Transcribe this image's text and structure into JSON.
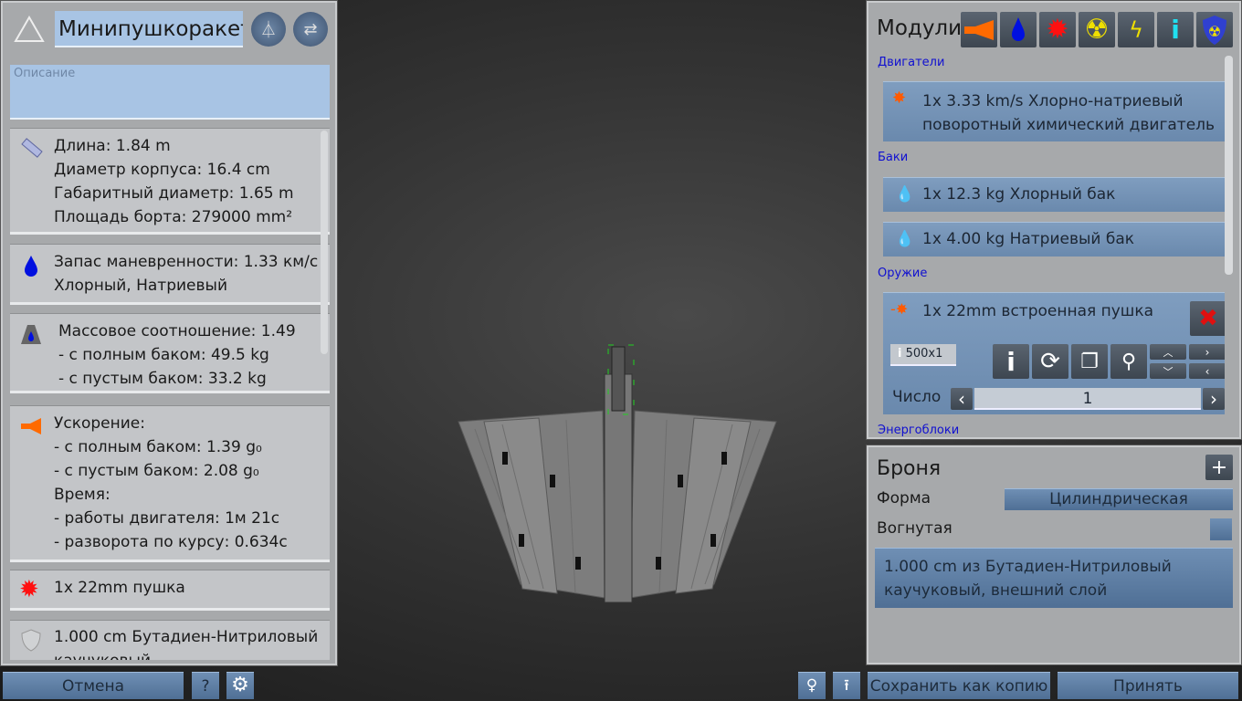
{
  "left": {
    "name_value": "Минипушкоракета",
    "description_placeholder": "Описание",
    "dims": [
      "Длина: 1.84 m",
      "Диаметр корпуса: 16.4 cm",
      "Габаритный диаметр: 1.65 m",
      "Площадь борта: 279000 mm²"
    ],
    "fuel": [
      "Запас маневренности: 1.33 км/с",
      "Хлорный, Натриевый"
    ],
    "mass": [
      "Массовое соотношение: 1.49",
      " - с полным баком: 49.5 kg",
      " - с пустым баком: 33.2 kg"
    ],
    "accel": [
      "Ускорение:",
      " - с полным баком: 1.39 g₀",
      " - с пустым баком: 2.08 g₀",
      "Время:",
      " - работы двигателя: 1м 21с",
      " - разворота по курсу: 0.634с"
    ],
    "weapon": "1x 22mm пушка",
    "armor": [
      "1.000 cm Бутадиен-Нитриловый",
      "каучуковый"
    ]
  },
  "bottom": {
    "cancel": "Отмена",
    "help": "?",
    "save_copy": "Сохранить как копию",
    "accept": "Принять"
  },
  "modules": {
    "title": "Модули",
    "filters": [
      "engine-icon",
      "tank-icon",
      "weapon-icon",
      "reactor-icon",
      "power-icon",
      "info-icon",
      "radiation-shield-icon"
    ],
    "sections": {
      "engines": "Двигатели",
      "tanks": "Баки",
      "weapons": "Оружие",
      "power": "Энергоблоки"
    },
    "engine": [
      "1x 3.33 km/s Хлорно-натриевый",
      "поворотный химический двигатель"
    ],
    "tanks": [
      "1x 12.3 kg Хлорный бак",
      "1x 4.00 kg Натриевый бак"
    ],
    "weapon": {
      "name": "1x 22mm встроенная пушка",
      "ammo": "500x1",
      "count_label": "Число",
      "count": "1"
    }
  },
  "armor": {
    "title": "Броня",
    "shape_label": "Форма",
    "shape_value": "Цилиндрическая",
    "concave_label": "Вогнутая",
    "layer": [
      "1.000 cm из Бутадиен-Нитриловый",
      "каучуковый, внешний слой"
    ]
  },
  "colors": {
    "accent": "#6a89ad",
    "engine": "#ff6a00",
    "tank": "#0010e0",
    "weapon": "#ff1010",
    "reactor": "#f0e000"
  }
}
